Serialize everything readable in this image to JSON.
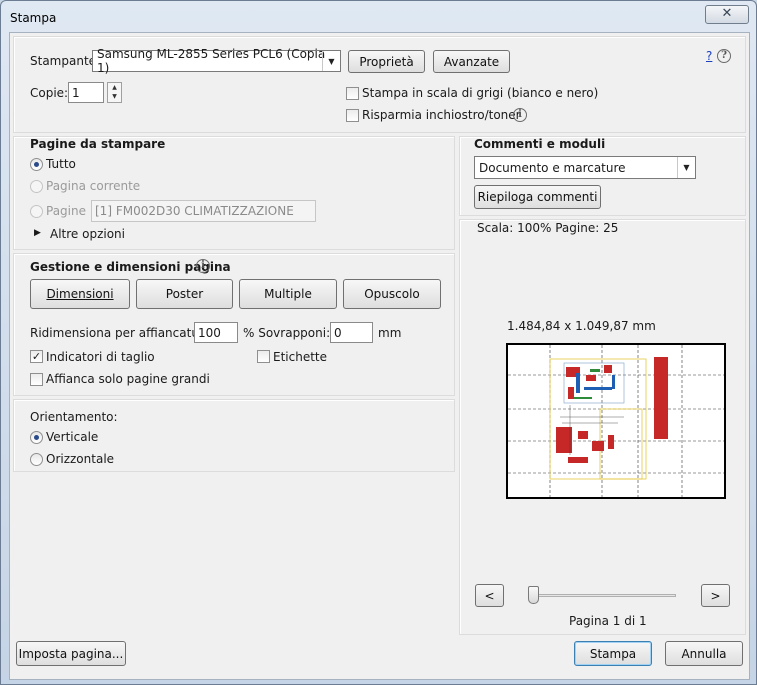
{
  "window": {
    "title": "Stampa",
    "close_symbol": "✕"
  },
  "printer": {
    "label": "Stampante:",
    "selected": "Samsung ML-2855 Series PCL6 (Copia 1)",
    "properties_button": "Proprietà",
    "advanced_button": "Avanzate",
    "help_link": "?",
    "copies_label": "Copie:",
    "copies_value": "1",
    "grayscale_label": "Stampa in scala di grigi (bianco e nero)",
    "grayscale_checked": false,
    "save_ink_label": "Risparmia inchiostro/toner",
    "save_ink_checked": false
  },
  "pages_to_print": {
    "heading": "Pagine da stampare",
    "all_label": "Tutto",
    "current_label": "Pagina corrente",
    "pages_label": "Pagine",
    "pages_value": "[1] FM002D30 CLIMATIZZAZIONE",
    "more_options_label": "Altre opzioni"
  },
  "page_handling": {
    "heading": "Gestione e dimensioni pagina",
    "tabs": [
      "Dimensioni",
      "Poster",
      "Multiple",
      "Opuscolo"
    ],
    "tile_scale_label": "Ridimensiona per affiancatura:",
    "tile_scale_value": "100",
    "overlap_label": "% Sovrapponi:",
    "overlap_value": "0",
    "overlap_unit": "mm",
    "cut_marks_label": "Indicatori di taglio",
    "cut_marks_checked": true,
    "labels_label": "Etichette",
    "labels_checked": false,
    "large_pages_label": "Affianca solo pagine grandi",
    "large_pages_checked": false
  },
  "orientation": {
    "heading": "Orientamento:",
    "portrait_label": "Verticale",
    "landscape_label": "Orizzontale",
    "selected": "portrait"
  },
  "comments": {
    "heading": "Commenti e moduli",
    "selected": "Documento e marcature",
    "summarize_button": "Riepiloga commenti"
  },
  "preview": {
    "scale_text": "Scala: 100% Pagine: 25",
    "dimensions_text": "1.484,84 x 1.049,87 mm",
    "prev_button": "<",
    "next_button": ">",
    "page_indicator": "Pagina 1 di 1"
  },
  "footer": {
    "page_setup_button": "Imposta pagina...",
    "print_button": "Stampa",
    "cancel_button": "Annulla"
  }
}
